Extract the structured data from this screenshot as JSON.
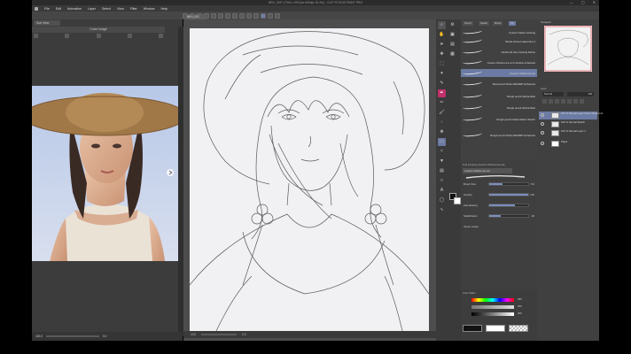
{
  "window": {
    "title": "NEH_002* (7344 x 9912px 600dpi 15.4%) - CLIP STUDIO PAINT PRO",
    "controls": [
      "—",
      "▢",
      "✕"
    ]
  },
  "menu": [
    "File",
    "Edit",
    "Animation",
    "Layer",
    "Select",
    "View",
    "Filter",
    "Window",
    "Help"
  ],
  "left_panel": {
    "tab": "Sub View",
    "header": "Cover Image",
    "status": [
      "100.0",
      "0.0"
    ]
  },
  "canvas": {
    "tab": "NEH_002",
    "status": [
      "10.0",
      "0.0"
    ]
  },
  "brush_panel": {
    "tabs": [
      "Pencil",
      "Pastel",
      "Brush",
      "Ink"
    ],
    "brushes": [
      "Custom Okuha Coloring",
      "Okuha Grimes watercolor 2",
      "Okuha Oil Like Coloring Refine",
      "Custom Okuha Line art 2 window enhanced",
      "Custom Okuha Line art",
      "Real pencil Okuha SECRET Enhanced",
      "Rough pencil Okuha Dark",
      "Rough pencil Okuha Dark",
      "Rough pencil Okuha Refine Sketch",
      "Rough pencil Okuha SECRET Enhanced"
    ],
    "selected": 4
  },
  "tool_property": {
    "header": "Tool property [Custom Okuha Line art]",
    "brush_name": "Custom Okuha Line art",
    "rows": [
      {
        "label": "Brush Size",
        "value": "5.6",
        "level": 0.35
      },
      {
        "label": "Opacity",
        "value": "100",
        "level": 1.0
      },
      {
        "label": "Anti-aliasing",
        "value": "",
        "level": 0.66
      },
      {
        "label": "Stabilization",
        "value": "20",
        "level": 0.3
      },
      {
        "label": "Vector eraser",
        "value": "",
        "level": 0
      }
    ]
  },
  "color_panel": {
    "header": "Color Slider",
    "values": [
      "255",
      "255",
      "255"
    ]
  },
  "navigator": {
    "header": "Navigator"
  },
  "layers": {
    "header": "Layer",
    "blend": "Normal",
    "opacity": "100",
    "items": [
      "100 % Normal Layer Clean Okuha Ink",
      "100 % Normal Sketch",
      "100 % Normal Layer 1",
      "Paper"
    ],
    "selected": 0
  },
  "colors": {
    "accent": "#6c7ba3",
    "panel": "#404040",
    "canvas_bg": "#4d4d4d",
    "paper": "#f1f0f3"
  }
}
